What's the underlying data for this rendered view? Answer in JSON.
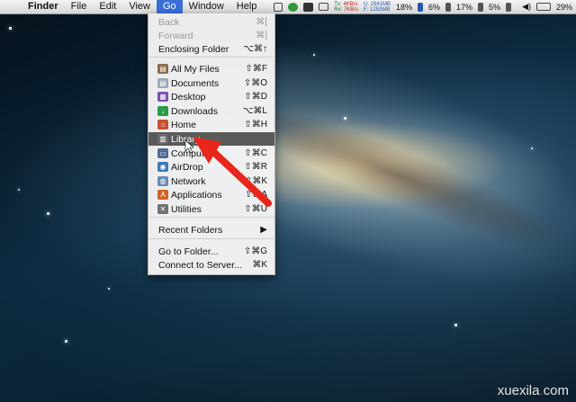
{
  "menubar": {
    "apple_icon": "apple-icon",
    "items": [
      "Finder",
      "File",
      "Edit",
      "View",
      "Go",
      "Window",
      "Help"
    ],
    "active_item": "Go",
    "status": {
      "net_tx_label": "Tx:",
      "net_tx": "4KB/s",
      "net_rx_label": "Rx:",
      "net_rx": "7KB/s",
      "mem_used": "U: 2841MB",
      "mem_free": "F: 1253MB",
      "cpu": "18%",
      "disk": "6%",
      "battery_a": "17%",
      "battery_b": "5%",
      "battery_level": "29%"
    }
  },
  "go_menu": {
    "items": [
      {
        "label": "Back",
        "shortcut": "⌘[",
        "icon": "",
        "disabled": true
      },
      {
        "label": "Forward",
        "shortcut": "⌘]",
        "icon": "",
        "disabled": true
      },
      {
        "label": "Enclosing Folder",
        "shortcut": "⌥⌘↑",
        "icon": ""
      },
      {
        "label": "All My Files",
        "shortcut": "⇧⌘F",
        "icon": "all-files-icon"
      },
      {
        "label": "Documents",
        "shortcut": "⇧⌘O",
        "icon": "documents-icon"
      },
      {
        "label": "Desktop",
        "shortcut": "⇧⌘D",
        "icon": "desktop-icon"
      },
      {
        "label": "Downloads",
        "shortcut": "⌥⌘L",
        "icon": "downloads-icon"
      },
      {
        "label": "Home",
        "shortcut": "⇧⌘H",
        "icon": "home-icon"
      },
      {
        "label": "Library",
        "shortcut": "",
        "icon": "library-icon",
        "selected": true
      },
      {
        "label": "Computer",
        "shortcut": "⇧⌘C",
        "icon": "computer-icon"
      },
      {
        "label": "AirDrop",
        "shortcut": "⇧⌘R",
        "icon": "airdrop-icon"
      },
      {
        "label": "Network",
        "shortcut": "⇧⌘K",
        "icon": "network-icon"
      },
      {
        "label": "Applications",
        "shortcut": "⇧⌘A",
        "icon": "applications-icon"
      },
      {
        "label": "Utilities",
        "shortcut": "⇧⌘U",
        "icon": "utilities-icon"
      },
      {
        "label": "Recent Folders",
        "shortcut": "▶",
        "icon": ""
      },
      {
        "label": "Go to Folder...",
        "shortcut": "⇧⌘G",
        "icon": ""
      },
      {
        "label": "Connect to Server...",
        "shortcut": "⌘K",
        "icon": ""
      }
    ]
  },
  "watermark": {
    "text_a": "xuexila",
    "dot": ".",
    "text_b": "com"
  },
  "colors": {
    "menu_active": "#3a6fd8",
    "selected_row": "#5a5a5a",
    "arrow": "#e8261b"
  }
}
